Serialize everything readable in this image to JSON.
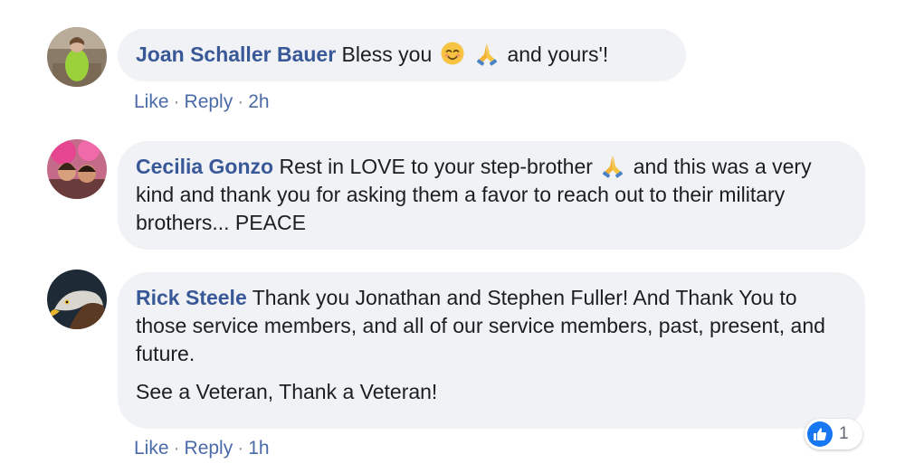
{
  "comments": [
    {
      "author": "Joan Schaller Bauer",
      "text_before": "Bless you",
      "text_after": "and yours'!",
      "emojis": [
        "smiling-face-icon",
        "folded-hands-icon"
      ],
      "actions": {
        "like": "Like",
        "reply": "Reply",
        "time": "2h"
      }
    },
    {
      "author": "Cecilia Gonzo",
      "text_before": "Rest in LOVE to your step-brother",
      "text_after": "and this was a very kind and thank you for asking them a favor to reach out to their military brothers... PEACE",
      "emojis": [
        "folded-hands-icon"
      ]
    },
    {
      "author": "Rick Steele",
      "text": "Thank you Jonathan and Stephen Fuller! And Thank You to those service members, and all of our service members, past, present, and future.",
      "text2": "See a Veteran, Thank a Veteran!",
      "actions": {
        "like": "Like",
        "reply": "Reply",
        "time": "1h"
      },
      "reactions": {
        "type": "like-icon",
        "count": "1"
      }
    }
  ],
  "separator": "·",
  "colors": {
    "author": "#385898",
    "bubble": "#f0f2f5",
    "meta": "#606770",
    "like_badge": "#1877f2"
  }
}
